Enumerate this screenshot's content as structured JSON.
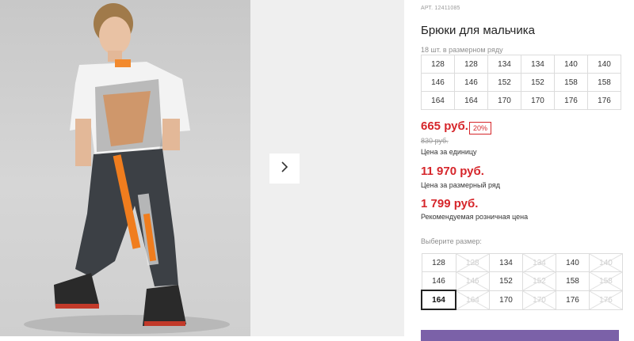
{
  "product": {
    "article": "АРТ. 12411085",
    "title": "Брюки для мальчика",
    "row_count": "18 шт. в размерном ряду"
  },
  "size_row": [
    [
      "128",
      "128",
      "134",
      "134",
      "140",
      "140"
    ],
    [
      "146",
      "146",
      "152",
      "152",
      "158",
      "158"
    ],
    [
      "164",
      "164",
      "170",
      "170",
      "176",
      "176"
    ]
  ],
  "pricing": {
    "price": "665 руб.",
    "discount": "20%",
    "old_price": "830 руб.",
    "unit_caption": "Цена за единицу",
    "row_price": "11 970 руб.",
    "row_caption": "Цена за размерный ряд",
    "retail_price": "1 799 руб.",
    "retail_caption": "Рекомендуемая розничная цена"
  },
  "size_picker": {
    "label": "Выберите размер:",
    "selected": "164",
    "rows": [
      [
        {
          "v": "128",
          "ok": true
        },
        {
          "v": "128",
          "ok": false
        },
        {
          "v": "134",
          "ok": true
        },
        {
          "v": "134",
          "ok": false
        },
        {
          "v": "140",
          "ok": true
        },
        {
          "v": "140",
          "ok": false
        }
      ],
      [
        {
          "v": "146",
          "ok": true
        },
        {
          "v": "146",
          "ok": false
        },
        {
          "v": "152",
          "ok": true
        },
        {
          "v": "152",
          "ok": false
        },
        {
          "v": "158",
          "ok": true
        },
        {
          "v": "158",
          "ok": false
        }
      ],
      [
        {
          "v": "164",
          "ok": true
        },
        {
          "v": "164",
          "ok": false
        },
        {
          "v": "170",
          "ok": true
        },
        {
          "v": "170",
          "ok": false
        },
        {
          "v": "176",
          "ok": true
        },
        {
          "v": "176",
          "ok": false
        }
      ]
    ]
  },
  "icons": {
    "next": "chevron-right-icon"
  },
  "colors": {
    "price": "#d6262b",
    "button": "#7b61a8"
  }
}
